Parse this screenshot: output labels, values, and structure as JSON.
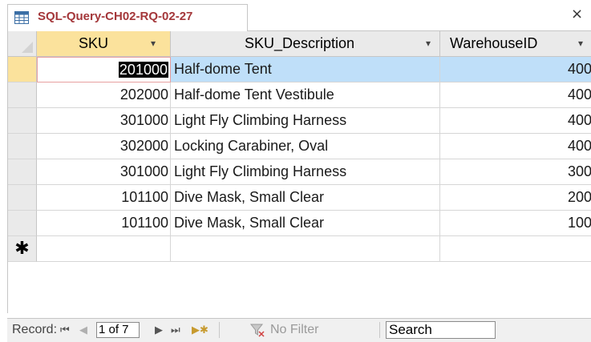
{
  "tab": {
    "title": "SQL-Query-CH02-RQ-02-27",
    "close_glyph": "×",
    "icon": "datasheet-icon"
  },
  "columns": [
    {
      "label": "SKU",
      "dropdown": "▾"
    },
    {
      "label": "SKU_Description",
      "dropdown": "▾"
    },
    {
      "label": "WarehouseID",
      "dropdown": "▾"
    }
  ],
  "rows": [
    {
      "sku": "201000",
      "description": "Half-dome Tent",
      "warehouse": "400"
    },
    {
      "sku": "202000",
      "description": "Half-dome Tent Vestibule",
      "warehouse": "400"
    },
    {
      "sku": "301000",
      "description": "Light Fly Climbing Harness",
      "warehouse": "400"
    },
    {
      "sku": "302000",
      "description": "Locking Carabiner, Oval",
      "warehouse": "400"
    },
    {
      "sku": "301000",
      "description": "Light Fly Climbing Harness",
      "warehouse": "300"
    },
    {
      "sku": "101100",
      "description": "Dive Mask, Small Clear",
      "warehouse": "200"
    },
    {
      "sku": "101100",
      "description": "Dive Mask, Small Clear",
      "warehouse": "100"
    }
  ],
  "new_record_marker": "✱",
  "navigation": {
    "record_label": "Record:",
    "first": "⏮",
    "prev": "◀",
    "position": "1 of 7",
    "next": "▶",
    "last": "⏭",
    "new": "▶✱",
    "filter_label": "No Filter",
    "search_label": "Search"
  },
  "colors": {
    "tab_title": "#a4373a",
    "selected_header": "#fbe29c",
    "selected_row": "#bfdff9"
  }
}
